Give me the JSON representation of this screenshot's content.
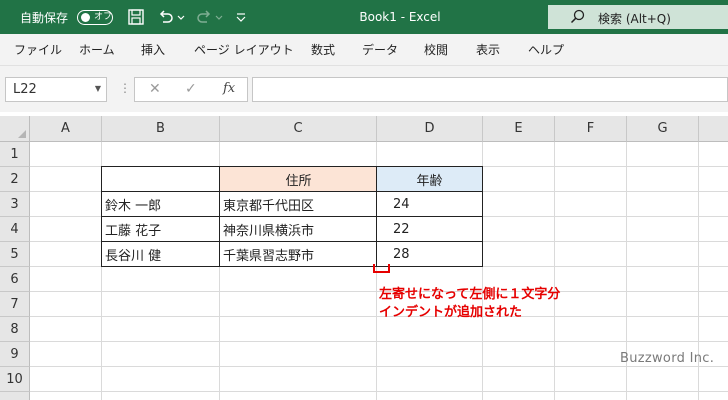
{
  "titlebar": {
    "autosave_label": "自動保存",
    "toggle_text": "オフ",
    "title": "Book1  -  Excel",
    "search_label": "検索 (Alt+Q)"
  },
  "ribbon": {
    "tabs": [
      "ファイル",
      "ホーム",
      "挿入",
      "ページ レイアウト",
      "数式",
      "データ",
      "校閲",
      "表示",
      "ヘルプ"
    ]
  },
  "formula_bar": {
    "name_box": "L22",
    "fx": "fx",
    "value": ""
  },
  "sheet": {
    "columns": [
      "A",
      "B",
      "C",
      "D",
      "E",
      "F",
      "G"
    ],
    "rows": [
      "1",
      "2",
      "3",
      "4",
      "5",
      "6",
      "7",
      "8",
      "9",
      "10"
    ],
    "header_address": "住所",
    "header_age": "年齢",
    "table": [
      {
        "name": "鈴木 一郎",
        "address": "東京都千代田区",
        "age": "24"
      },
      {
        "name": "工藤 花子",
        "address": "神奈川県横浜市",
        "age": "22"
      },
      {
        "name": "長谷川 健",
        "address": "千葉県習志野市",
        "age": "28"
      }
    ]
  },
  "annotation": {
    "line1": "左寄せになって左側に１文字分",
    "line2": "インデントが追加された"
  },
  "watermark": "Buzzword Inc.",
  "colors": {
    "excel_green": "#217346",
    "header_address_fill": "#fce4d6",
    "header_age_fill": "#ddebf7",
    "annotation_red": "#e60000"
  }
}
